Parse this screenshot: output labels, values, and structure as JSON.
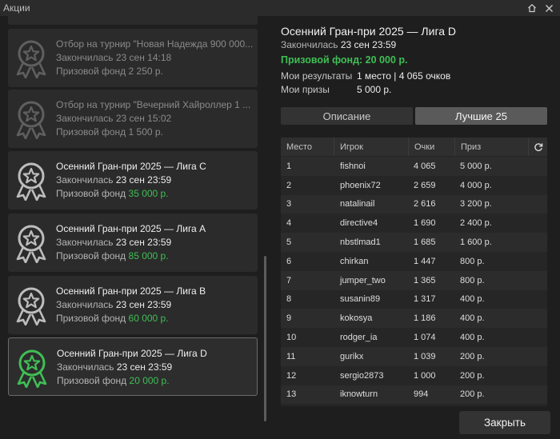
{
  "window": {
    "title": "Акции"
  },
  "tournaments": [
    {
      "name": "Отбор на турнир \"Новая Надежда 900 000...",
      "ended_label": "Закончилась",
      "ended_value": "23 сен 14:18",
      "fund_label": "Призовой фонд",
      "fund_value": "2 250 р.",
      "state": "dim"
    },
    {
      "name": "Отбор на турнир \"Вечерний Хайроллер 1 ...",
      "ended_label": "Закончилась",
      "ended_value": "23 сен 15:02",
      "fund_label": "Призовой фонд",
      "fund_value": "1 500 р.",
      "state": "dim"
    },
    {
      "name": "Осенний Гран-при 2025 — Лига C",
      "ended_label": "Закончилась",
      "ended_value": "23 сен 23:59",
      "fund_label": "Призовой фонд",
      "fund_value": "35 000 р.",
      "state": "normal"
    },
    {
      "name": "Осенний Гран-при 2025 — Лига A",
      "ended_label": "Закончилась",
      "ended_value": "23 сен 23:59",
      "fund_label": "Призовой фонд",
      "fund_value": "85 000 р.",
      "state": "normal"
    },
    {
      "name": "Осенний Гран-при 2025 — Лига B",
      "ended_label": "Закончилась",
      "ended_value": "23 сен 23:59",
      "fund_label": "Призовой фонд",
      "fund_value": "60 000 р.",
      "state": "normal"
    },
    {
      "name": "Осенний Гран-при 2025 — Лига D",
      "ended_label": "Закончилась",
      "ended_value": "23 сен 23:59",
      "fund_label": "Призовой фонд",
      "fund_value": "20 000 р.",
      "state": "selected"
    }
  ],
  "details": {
    "title": "Осенний Гран-при 2025 — Лига D",
    "ended_label": "Закончилась",
    "ended_value": "23 сен 23:59",
    "prize_fund": "Призовой фонд: 20 000 р.",
    "results_label": "Мои результаты",
    "results_value": "1 место | 4 065 очков",
    "prizes_label": "Мои призы",
    "prizes_value": "5 000 р."
  },
  "tabs": [
    {
      "label": "Описание",
      "active": false
    },
    {
      "label": "Лучшие 25",
      "active": true
    }
  ],
  "leaderboard": {
    "columns": [
      "Место",
      "Игрок",
      "Очки",
      "Приз"
    ],
    "rows": [
      [
        "1",
        "fishnoi",
        "4 065",
        "5 000 р."
      ],
      [
        "2",
        "phoenix72",
        "2 659",
        "4 000 р."
      ],
      [
        "3",
        "natalinail",
        "2 616",
        "3 200 р."
      ],
      [
        "4",
        "directive4",
        "1 690",
        "2 400 р."
      ],
      [
        "5",
        "nbstlmad1",
        "1 685",
        "1 600 р."
      ],
      [
        "6",
        "chirkan",
        "1 447",
        "800 р."
      ],
      [
        "7",
        "jumper_two",
        "1 365",
        "800 р."
      ],
      [
        "8",
        "susanin89",
        "1 317",
        "400 р."
      ],
      [
        "9",
        "kokosya",
        "1 186",
        "400 р."
      ],
      [
        "10",
        "rodger_ia",
        "1 074",
        "400 р."
      ],
      [
        "11",
        "gurikx",
        "1 039",
        "200 р."
      ],
      [
        "12",
        "sergio2873",
        "1 000",
        "200 р."
      ],
      [
        "13",
        "iknowturn",
        "994",
        "200 р."
      ]
    ]
  },
  "buttons": {
    "close": "Закрыть"
  },
  "colors": {
    "accent_green": "#3fbf55",
    "background": "#1e1e1e",
    "card": "#2b2b2b"
  },
  "icons": [
    "home-icon",
    "close-icon",
    "medal-icon",
    "refresh-icon"
  ]
}
